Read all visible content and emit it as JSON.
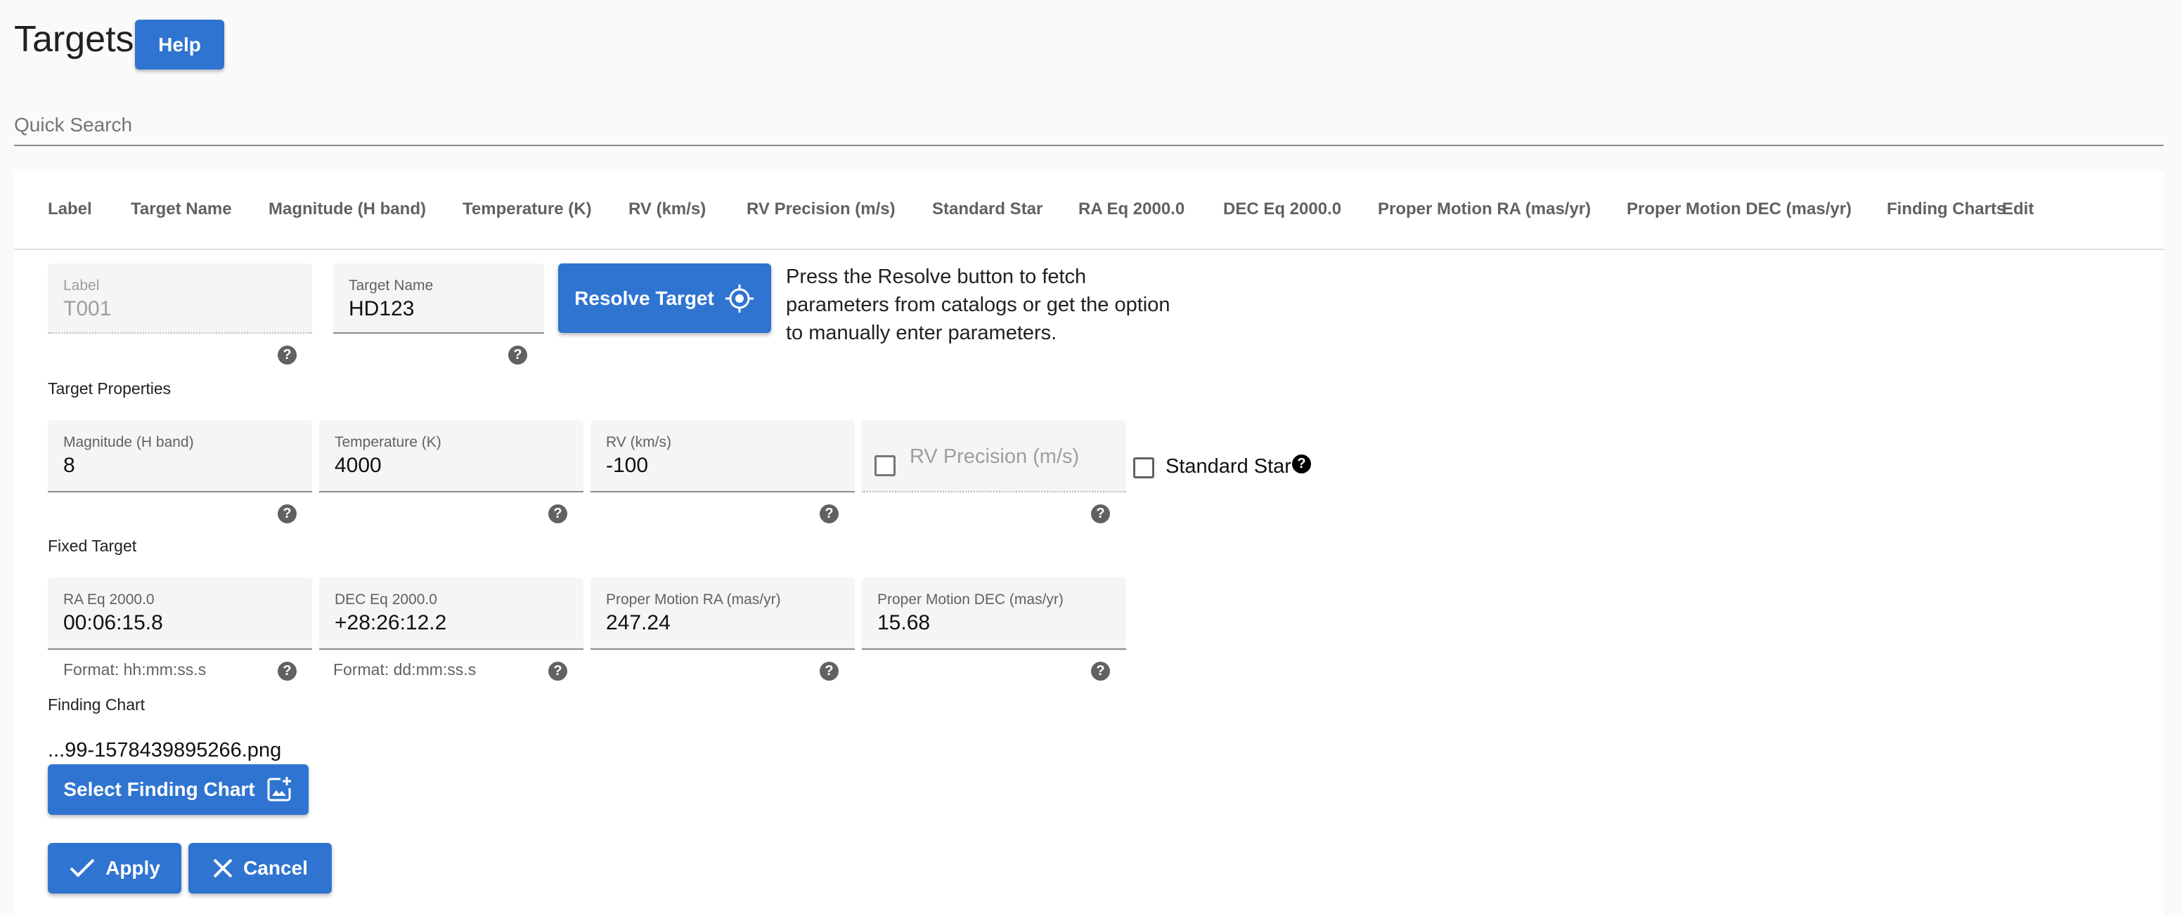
{
  "page": {
    "title": "Targets",
    "help_label": "Help",
    "search_placeholder": "Quick Search"
  },
  "table": {
    "columns": [
      "Label",
      "Target Name",
      "Magnitude (H band)",
      "Temperature (K)",
      "RV (km/s)",
      "RV Precision (m/s)",
      "Standard Star",
      "RA Eq 2000.0",
      "DEC Eq 2000.0",
      "Proper Motion RA (mas/yr)",
      "Proper Motion DEC (mas/yr)",
      "Finding Charts",
      "Edit"
    ]
  },
  "form": {
    "label": {
      "label": "Label",
      "value": "T001"
    },
    "target_name": {
      "label": "Target Name",
      "value": "HD123"
    },
    "resolve_label": "Resolve Target",
    "resolve_note": "Press the Resolve button to fetch parameters from catalogs or get the option to manually enter parameters.",
    "target_properties_heading": "Target Properties",
    "magnitude": {
      "label": "Magnitude (H band)",
      "value": "8"
    },
    "temperature": {
      "label": "Temperature (K)",
      "value": "4000"
    },
    "rv": {
      "label": "RV (km/s)",
      "value": "-100"
    },
    "rv_precision": {
      "label": "RV Precision (m/s)",
      "checked": false
    },
    "standard_star": {
      "label": "Standard Star",
      "checked": false
    },
    "fixed_target_heading": "Fixed Target",
    "ra": {
      "label": "RA Eq 2000.0",
      "value": "00:06:15.8",
      "format": "Format: hh:mm:ss.s"
    },
    "dec": {
      "label": "DEC Eq 2000.0",
      "value": "+28:26:12.2",
      "format": "Format: dd:mm:ss.s"
    },
    "pm_ra": {
      "label": "Proper Motion RA (mas/yr)",
      "value": "247.24"
    },
    "pm_dec": {
      "label": "Proper Motion DEC (mas/yr)",
      "value": "15.68"
    },
    "finding_chart_heading": "Finding Chart",
    "finding_chart_file": "...99-1578439895266.png",
    "select_chart_label": "Select Finding Chart",
    "apply_label": "Apply",
    "cancel_label": "Cancel"
  },
  "icons": {
    "help": "question-circle-icon",
    "resolve": "crosshair-icon",
    "select_chart": "add-photo-icon",
    "apply": "check-icon",
    "cancel": "close-icon"
  },
  "colors": {
    "primary": "#2f74d0",
    "background": "#fafafa"
  }
}
